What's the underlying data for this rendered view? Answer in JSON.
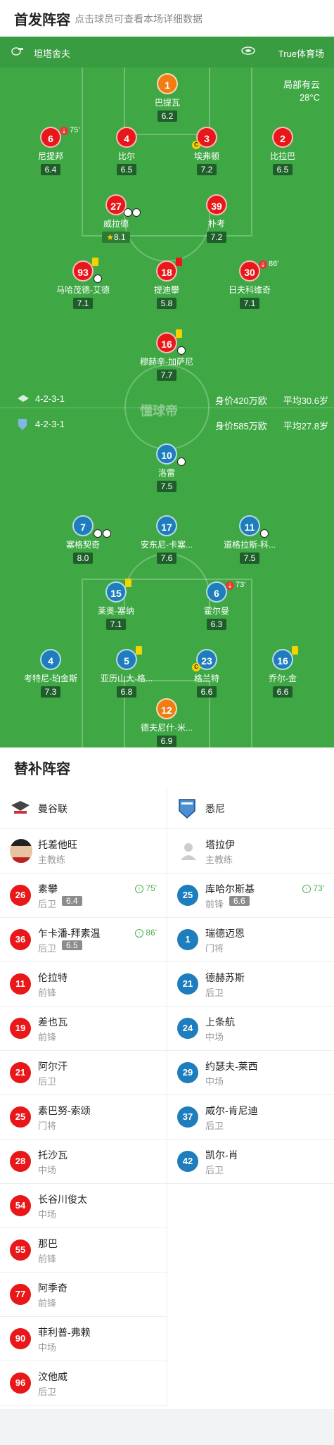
{
  "header": {
    "title": "首发阵容",
    "subtitle": "点击球员可查看本场详细数据"
  },
  "pitch": {
    "referee": "坦塔舍夫",
    "venue": "True体育场",
    "weather": "局部有云",
    "temperature": "28°C",
    "watermark": "懂球帝"
  },
  "home": {
    "formation": "4-2-3-1",
    "value": "身价420万欧",
    "age": "平均30.6岁",
    "players": [
      {
        "num": "1",
        "name": "巴提瓦",
        "rating": "6.2"
      },
      {
        "num": "6",
        "name": "尼提邦",
        "rating": "6.4",
        "subMin": "75'"
      },
      {
        "num": "4",
        "name": "比尔",
        "rating": "6.5"
      },
      {
        "num": "3",
        "name": "埃弗顿",
        "rating": "7.2"
      },
      {
        "num": "2",
        "name": "比拉巴",
        "rating": "6.5"
      },
      {
        "num": "27",
        "name": "威拉德",
        "rating": "8.1"
      },
      {
        "num": "39",
        "name": "朴考",
        "rating": "7.2"
      },
      {
        "num": "93",
        "name": "马哈茂德-艾德",
        "rating": "7.1"
      },
      {
        "num": "18",
        "name": "提迪攀",
        "rating": "5.8"
      },
      {
        "num": "30",
        "name": "日夫科维奇",
        "rating": "7.1",
        "subMin": "86'"
      },
      {
        "num": "16",
        "name": "穆赫辛-加萨尼",
        "rating": "7.7"
      }
    ]
  },
  "away": {
    "formation": "4-2-3-1",
    "value": "身价585万欧",
    "age": "平均27.8岁",
    "players": [
      {
        "num": "10",
        "name": "洛雷",
        "rating": "7.5"
      },
      {
        "num": "7",
        "name": "塞格契奇",
        "rating": "8.0"
      },
      {
        "num": "17",
        "name": "安东尼-卡塞...",
        "rating": "7.6"
      },
      {
        "num": "11",
        "name": "道格拉斯-科...",
        "rating": "7.5"
      },
      {
        "num": "15",
        "name": "莱奥-塞纳",
        "rating": "7.1"
      },
      {
        "num": "6",
        "name": "霍尔曼",
        "rating": "6.3",
        "subMin": "73'"
      },
      {
        "num": "4",
        "name": "考特尼-珀金斯",
        "rating": "7.3"
      },
      {
        "num": "5",
        "name": "亚历山大-格...",
        "rating": "6.8"
      },
      {
        "num": "23",
        "name": "格兰特",
        "rating": "6.6"
      },
      {
        "num": "16",
        "name": "乔尔-金",
        "rating": "6.6"
      },
      {
        "num": "12",
        "name": "德夫尼什-米...",
        "rating": "6.9"
      }
    ]
  },
  "subs": {
    "title": "替补阵容",
    "home": {
      "team": "曼谷联",
      "coach": {
        "name": "托差他旺",
        "role": "主教练"
      },
      "players": [
        {
          "num": "26",
          "name": "素攀",
          "pos": "后卫",
          "rating": "6.4",
          "inMin": "75'"
        },
        {
          "num": "36",
          "name": "乍卡潘-拜素温",
          "pos": "后卫",
          "rating": "6.5",
          "inMin": "86'"
        },
        {
          "num": "11",
          "name": "伦拉特",
          "pos": "前锋"
        },
        {
          "num": "19",
          "name": "差也瓦",
          "pos": "前锋"
        },
        {
          "num": "21",
          "name": "阿尔汗",
          "pos": "后卫"
        },
        {
          "num": "25",
          "name": "素巴努-索颂",
          "pos": "门将"
        },
        {
          "num": "28",
          "name": "托沙瓦",
          "pos": "中场"
        },
        {
          "num": "54",
          "name": "长谷川俊太",
          "pos": "中场"
        },
        {
          "num": "55",
          "name": "那巴",
          "pos": "前锋"
        },
        {
          "num": "77",
          "name": "阿季奇",
          "pos": "前锋"
        },
        {
          "num": "90",
          "name": "菲利普-弗赖",
          "pos": "中场"
        },
        {
          "num": "96",
          "name": "汶他威",
          "pos": "后卫"
        }
      ]
    },
    "away": {
      "team": "悉尼",
      "coach": {
        "name": "塔拉伊",
        "role": "主教练"
      },
      "players": [
        {
          "num": "25",
          "name": "库哈尔斯基",
          "pos": "前锋",
          "rating": "6.6",
          "inMin": "73'"
        },
        {
          "num": "1",
          "name": "瑞德迈恩",
          "pos": "门将"
        },
        {
          "num": "21",
          "name": "德赫苏斯",
          "pos": "后卫"
        },
        {
          "num": "24",
          "name": "上条航",
          "pos": "中场"
        },
        {
          "num": "29",
          "name": "约瑟夫-莱西",
          "pos": "中场"
        },
        {
          "num": "37",
          "name": "威尔-肯尼迪",
          "pos": "后卫"
        },
        {
          "num": "42",
          "name": "凯尔-肖",
          "pos": "后卫"
        }
      ]
    }
  },
  "colors": {
    "home": "#e8171a",
    "away": "#1d7dbd",
    "keeper": "#f07c12",
    "pitch": "#3fa845"
  }
}
